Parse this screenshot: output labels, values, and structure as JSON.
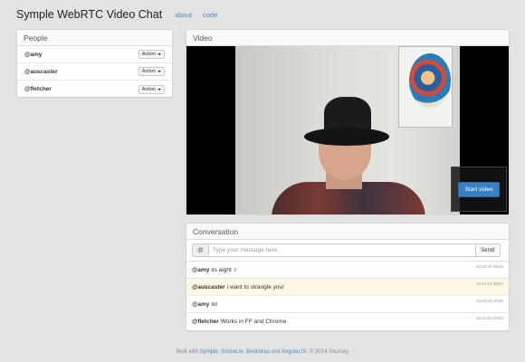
{
  "navbar": {
    "brand": "Symple WebRTC Video Chat",
    "links": [
      "about",
      "code"
    ]
  },
  "people": {
    "title": "People",
    "items": [
      {
        "name": "@amy",
        "action": "Action"
      },
      {
        "name": "@auscaster",
        "action": "Action"
      },
      {
        "name": "@fletcher",
        "action": "Action"
      }
    ]
  },
  "video": {
    "title": "Video",
    "start_label": "Start video"
  },
  "conversation": {
    "title": "Conversation",
    "at_symbol": "@",
    "placeholder": "Type your message here",
    "send_label": "Send!",
    "messages": [
      {
        "user": "@amy",
        "text": "its aight :/",
        "time": "15:53:34 05/03",
        "highlight": false
      },
      {
        "user": "@auscaster",
        "text": "i want to strangle you!",
        "time": "15:54:13 05/03",
        "highlight": true
      },
      {
        "user": "@amy",
        "text": "lol",
        "time": "15:54:22 05/03",
        "highlight": false
      },
      {
        "user": "@fletcher",
        "text": "Works in FF and Chrome",
        "time": "15:11:53 05/03",
        "highlight": false
      }
    ]
  },
  "footer": {
    "prefix": "Built with",
    "link1": "Symple",
    "sep1": ",",
    "link2": "Socket.io",
    "sep2": ",",
    "link3": "Bootstrap",
    "and": "and",
    "link4": "AngularJS",
    "suffix": ". © 2014 Sourcey"
  },
  "colors": {
    "accent": "#428bca",
    "start_button": "#3a7fc1",
    "highlight_row": "#fcf8e3"
  }
}
